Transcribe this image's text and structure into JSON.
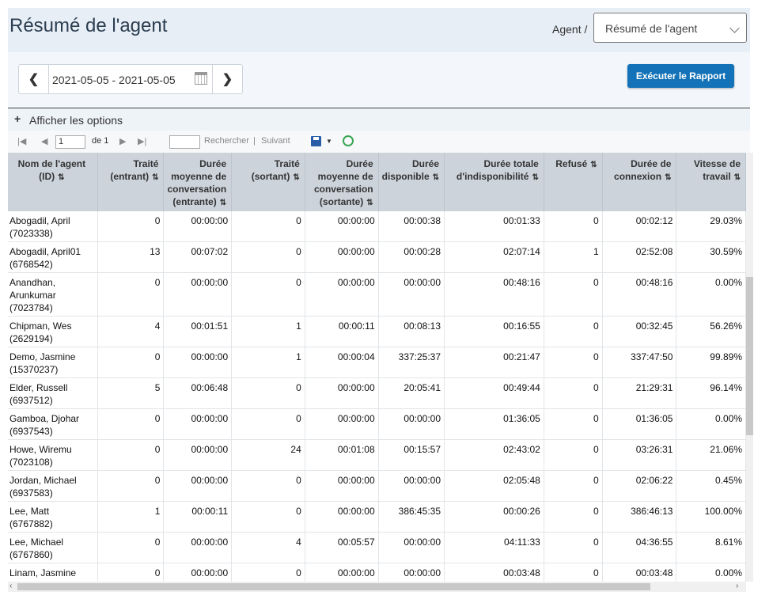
{
  "header": {
    "title": "Résumé de l'agent",
    "breadcrumb": "Agent /",
    "report_select": "Résumé de l'agent"
  },
  "filters": {
    "date_range": "2021-05-05 - 2021-05-05",
    "run_button": "Exécuter le Rapport"
  },
  "options": {
    "toggle_label": "Afficher les options"
  },
  "pager": {
    "page_value": "1",
    "page_of": "de 1",
    "search_value": "",
    "find_label": "Rechercher",
    "separator": "|",
    "next_label": "Suivant"
  },
  "table": {
    "columns": [
      "Nom de l'agent (ID)",
      "Traité (entrant)",
      "Durée moyenne de conversation (entrante)",
      "Traité (sortant)",
      "Durée moyenne de conversation (sortante)",
      "Durée disponible",
      "Durée totale d'indisponibilité",
      "Refusé",
      "Durée de connexion",
      "Vitesse de travail"
    ],
    "rows": [
      [
        "Abogadil, April (7023338)",
        "0",
        "00:00:00",
        "0",
        "00:00:00",
        "00:00:38",
        "00:01:33",
        "0",
        "00:02:12",
        "29.03%"
      ],
      [
        "Abogadil, April01 (6768542)",
        "13",
        "00:07:02",
        "0",
        "00:00:00",
        "00:00:28",
        "02:07:14",
        "1",
        "02:52:08",
        "30.59%"
      ],
      [
        "Anandhan, Arunkumar (7023784)",
        "0",
        "00:00:00",
        "0",
        "00:00:00",
        "00:00:00",
        "00:48:16",
        "0",
        "00:48:16",
        "0.00%"
      ],
      [
        "Chipman, Wes (2629194)",
        "4",
        "00:01:51",
        "1",
        "00:00:11",
        "00:08:13",
        "00:16:55",
        "0",
        "00:32:45",
        "56.26%"
      ],
      [
        "Demo, Jasmine (15370237)",
        "0",
        "00:00:00",
        "1",
        "00:00:04",
        "337:25:37",
        "00:21:47",
        "0",
        "337:47:50",
        "99.89%"
      ],
      [
        "Elder, Russell (6937512)",
        "5",
        "00:06:48",
        "0",
        "00:00:00",
        "20:05:41",
        "00:49:44",
        "0",
        "21:29:31",
        "96.14%"
      ],
      [
        "Gamboa, Djohar (6937543)",
        "0",
        "00:00:00",
        "0",
        "00:00:00",
        "00:00:00",
        "01:36:05",
        "0",
        "01:36:05",
        "0.00%"
      ],
      [
        "Howe, Wiremu (7023108)",
        "0",
        "00:00:00",
        "24",
        "00:01:08",
        "00:15:57",
        "02:43:02",
        "0",
        "03:26:31",
        "21.06%"
      ],
      [
        "Jordan, Michael (6937583)",
        "0",
        "00:00:00",
        "0",
        "00:00:00",
        "00:00:00",
        "02:05:48",
        "0",
        "02:06:22",
        "0.45%"
      ],
      [
        "Lee, Matt (6767882)",
        "1",
        "00:00:11",
        "0",
        "00:00:00",
        "386:45:35",
        "00:00:26",
        "0",
        "386:46:13",
        "100.00%"
      ],
      [
        "Lee, Michael (6767860)",
        "0",
        "00:00:00",
        "4",
        "00:05:57",
        "00:00:00",
        "04:11:33",
        "0",
        "04:36:55",
        "8.61%"
      ],
      [
        "Linam, Jasmine (15370209)",
        "0",
        "00:00:00",
        "0",
        "00:00:00",
        "00:00:00",
        "00:03:48",
        "0",
        "00:03:48",
        "0.00%"
      ]
    ]
  }
}
